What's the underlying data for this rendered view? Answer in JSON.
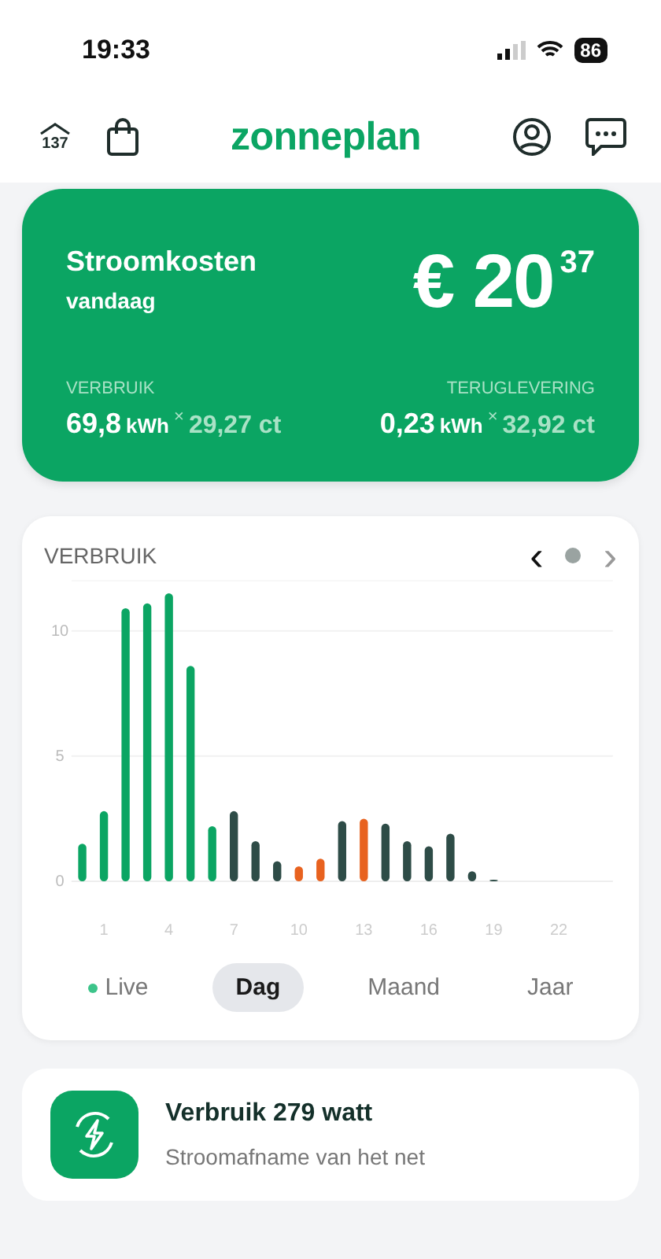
{
  "status_bar": {
    "time": "19:33",
    "battery": "86"
  },
  "header": {
    "badge_number": "137",
    "logo": "zonneplan"
  },
  "cost_card": {
    "title": "Stroomkosten",
    "subtitle": "vandaag",
    "currency": "€",
    "amount_whole": "20",
    "amount_cents": "37",
    "stats": [
      {
        "label": "VERBRUIK",
        "value": "69,8",
        "unit": "kWh",
        "times": "×",
        "rate": "29,27 ct"
      },
      {
        "label": "TERUGLEVERING",
        "value": "0,23",
        "unit": "kWh",
        "times": "×",
        "rate": "32,92 ct"
      }
    ]
  },
  "usage_card": {
    "title": "VERBRUIK",
    "prev": "‹",
    "next": "›",
    "chart_data": {
      "type": "bar",
      "stacked": true,
      "x": [
        0,
        1,
        2,
        3,
        4,
        5,
        6,
        7,
        8,
        9,
        10,
        11,
        12,
        13,
        14,
        15,
        16,
        17,
        18,
        19
      ],
      "xlim": [
        -0.5,
        24.5
      ],
      "ylim": [
        0,
        12
      ],
      "xticks": [
        1,
        4,
        7,
        10,
        13,
        16,
        19,
        22
      ],
      "yticks": [
        0,
        5,
        10
      ],
      "series": [
        {
          "color": "#0ba563",
          "values": [
            1.5,
            2.8,
            10.9,
            11.1,
            11.5,
            8.6,
            2.2,
            null,
            null,
            null,
            null,
            null,
            null,
            null,
            null,
            null,
            null,
            null,
            null,
            null
          ]
        },
        {
          "color": "#2e4c47",
          "values": [
            null,
            null,
            null,
            null,
            null,
            null,
            null,
            2.8,
            1.6,
            0.8,
            null,
            null,
            2.4,
            null,
            2.3,
            1.6,
            1.4,
            1.9,
            0.4,
            0.05
          ]
        },
        {
          "color": "#e8621f",
          "values": [
            null,
            null,
            null,
            null,
            null,
            null,
            null,
            null,
            null,
            null,
            0.6,
            0.9,
            null,
            2.5,
            null,
            null,
            null,
            null,
            null,
            null
          ]
        }
      ]
    },
    "periods": [
      {
        "label": "Live",
        "selected": false,
        "kind": "live"
      },
      {
        "label": "Dag",
        "selected": true,
        "kind": "plain"
      },
      {
        "label": "Maand",
        "selected": false,
        "kind": "plain"
      },
      {
        "label": "Jaar",
        "selected": false,
        "kind": "plain"
      }
    ]
  },
  "live_card": {
    "title": "Verbruik 279 watt",
    "subtitle": "Stroomafname van het net"
  }
}
